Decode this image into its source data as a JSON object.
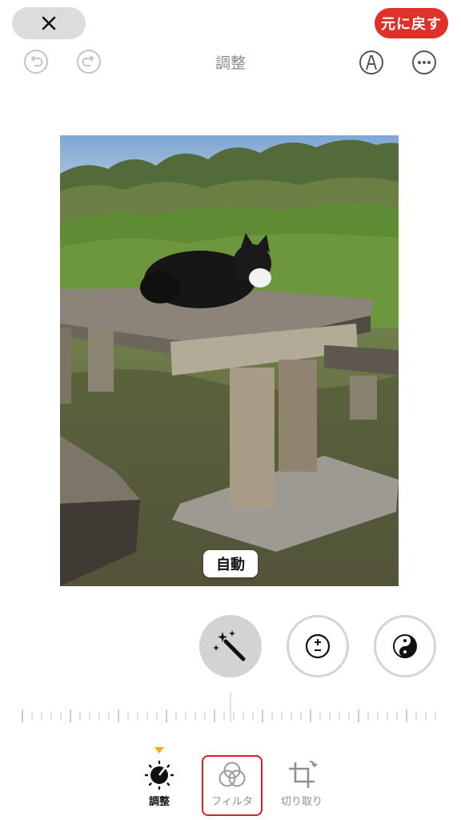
{
  "header": {
    "title": "調整",
    "revert_label": "元に戻す"
  },
  "photo": {
    "badge_label": "自動",
    "description_icon": "cat-on-picnic-table"
  },
  "tools": [
    {
      "name": "auto-enhance",
      "icon": "magic-wand-icon",
      "active": true
    },
    {
      "name": "exposure",
      "icon": "plus-minus-icon",
      "active": false
    },
    {
      "name": "brilliance",
      "icon": "yin-yang-icon",
      "active": false
    }
  ],
  "tabs": [
    {
      "label": "調整",
      "icon": "adjust-dial-icon",
      "selected": true
    },
    {
      "label": "フィルタ",
      "icon": "filters-icon",
      "selected": false
    },
    {
      "label": "切り取り",
      "icon": "crop-icon",
      "selected": false
    }
  ],
  "colors": {
    "accent_red": "#e0302a",
    "highlight_red": "#d6202a",
    "indicator_yellow": "#f0b000"
  }
}
